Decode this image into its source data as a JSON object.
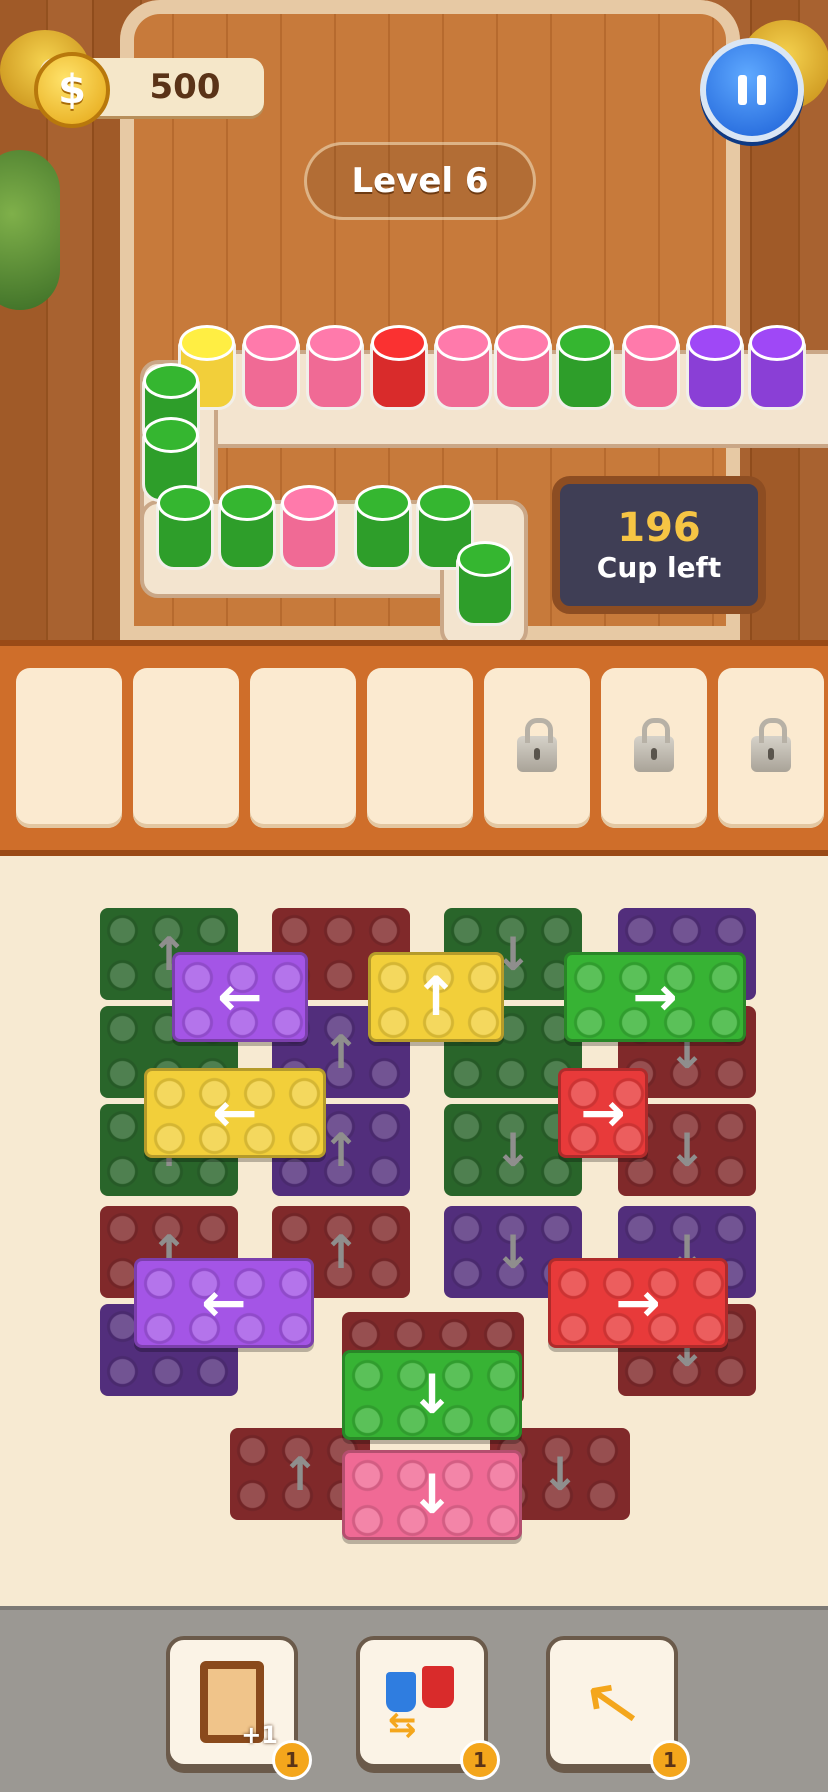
{
  "hud": {
    "coins": "500",
    "coin_symbol": "$",
    "level": "Level 6",
    "cups_left_count": "196",
    "cups_left_label": "Cup left"
  },
  "slots": {
    "total": 7,
    "unlocked": 4,
    "locked": 3
  },
  "boosters": [
    {
      "name": "add-slot",
      "icon": "frame-plus-one-icon",
      "caption": "+1",
      "count": "1"
    },
    {
      "name": "swap-cups",
      "icon": "swap-cups-icon",
      "count": "1"
    },
    {
      "name": "undo",
      "icon": "curved-arrow-icon",
      "count": "1"
    }
  ],
  "colors": {
    "green": "#2e9e2a",
    "red": "#d92b2b",
    "pink": "#f06a95",
    "yellow": "#f2cf3a",
    "purple": "#8a3fd6",
    "dark_green": "#1f5e22",
    "dark_red": "#7a1f22",
    "dark_purple": "#4a2478"
  }
}
